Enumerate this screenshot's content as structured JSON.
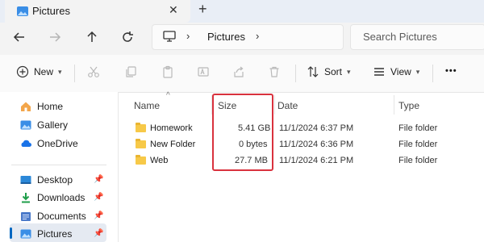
{
  "window": {
    "tab_title": "Pictures",
    "tab_close": "✕",
    "new_tab": "+"
  },
  "address": {
    "crumbs": [
      "Pictures"
    ],
    "search_placeholder": "Search Pictures"
  },
  "toolbar": {
    "new_label": "New",
    "sort_label": "Sort",
    "view_label": "View",
    "more_label": "•••"
  },
  "sidebar": {
    "items": [
      {
        "label": "Home",
        "icon": "home-icon"
      },
      {
        "label": "Gallery",
        "icon": "gallery-icon"
      },
      {
        "label": "OneDrive",
        "icon": "cloud-icon"
      },
      {
        "label": "Desktop",
        "icon": "desktop-icon",
        "pinned": true
      },
      {
        "label": "Downloads",
        "icon": "download-icon",
        "pinned": true
      },
      {
        "label": "Documents",
        "icon": "documents-icon",
        "pinned": true
      },
      {
        "label": "Pictures",
        "icon": "pictures-icon",
        "pinned": true,
        "selected": true
      }
    ]
  },
  "columns": {
    "name": "Name",
    "size": "Size",
    "date": "Date",
    "type": "Type"
  },
  "rows": [
    {
      "name": "Homework",
      "size": "5.41 GB",
      "date": "11/1/2024 6:37 PM",
      "type": "File folder"
    },
    {
      "name": "New Folder",
      "size": "0 bytes",
      "date": "11/1/2024 6:36 PM",
      "type": "File folder"
    },
    {
      "name": "Web",
      "size": "27.7 MB",
      "date": "11/1/2024 6:21 PM",
      "type": "File folder"
    }
  ],
  "colors": {
    "accent": "#0067c0",
    "highlight_box": "#d9323e",
    "folder": "#f7c948"
  }
}
